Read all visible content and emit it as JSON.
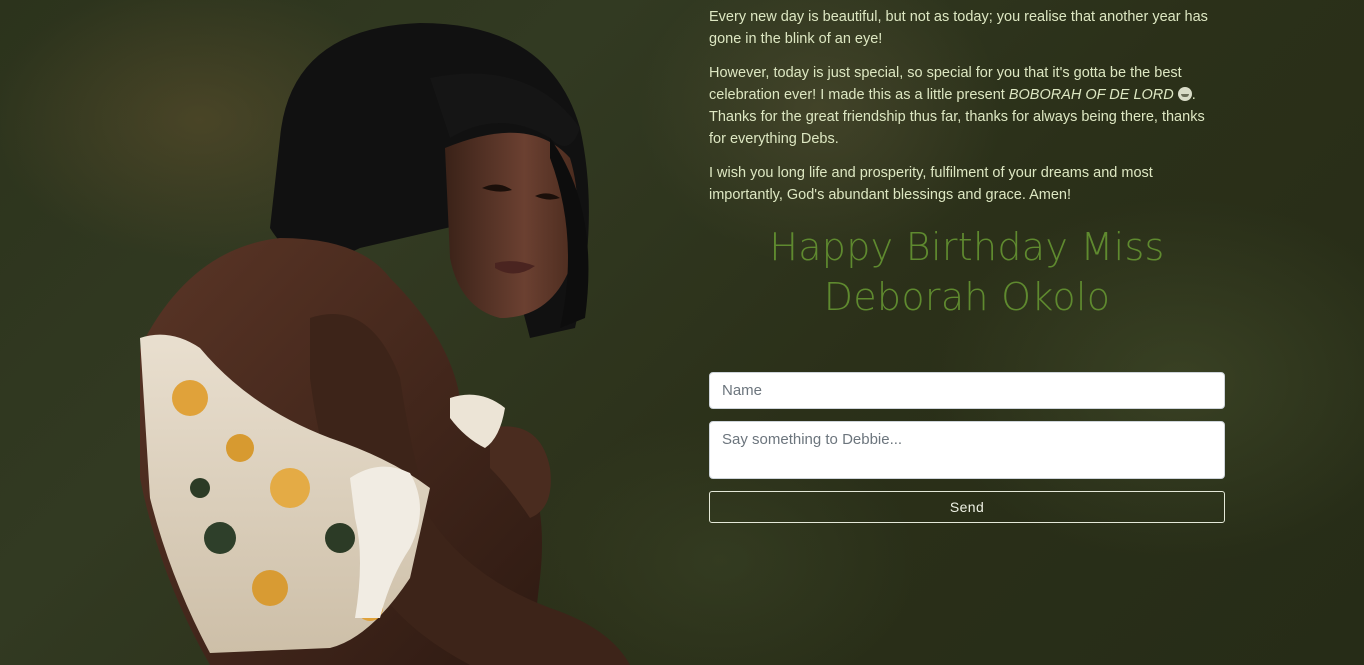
{
  "message": {
    "paragraph_1": "Every new day is beautiful, but not as today; you realise that another year has gone in the blink of an eye!",
    "paragraph_2_start": "However, today is just special, so special for you that it's gotta be the best celebration ever! I made this as a little present ",
    "paragraph_2_emphasis": "BOBORAH OF DE LORD",
    "paragraph_2_end": ". Thanks for the great friendship thus far, thanks for always being there, thanks for everything Debs.",
    "paragraph_3": "I wish you long life and prosperity, fulfilment of your dreams and most importantly, God's abundant blessings and grace. Amen!",
    "emoji_icon": "grinning-face-icon"
  },
  "headline": {
    "line_1": "Happy Birthday Miss",
    "line_2": "Deborah Okolo"
  },
  "form": {
    "name_placeholder": "Name",
    "name_value": "",
    "message_placeholder": "Say something to Debbie...",
    "message_value": "",
    "send_label": "Send"
  },
  "colors": {
    "headline": "#5f8a2f",
    "text": "#dde7c2",
    "background": "#2c331c"
  }
}
